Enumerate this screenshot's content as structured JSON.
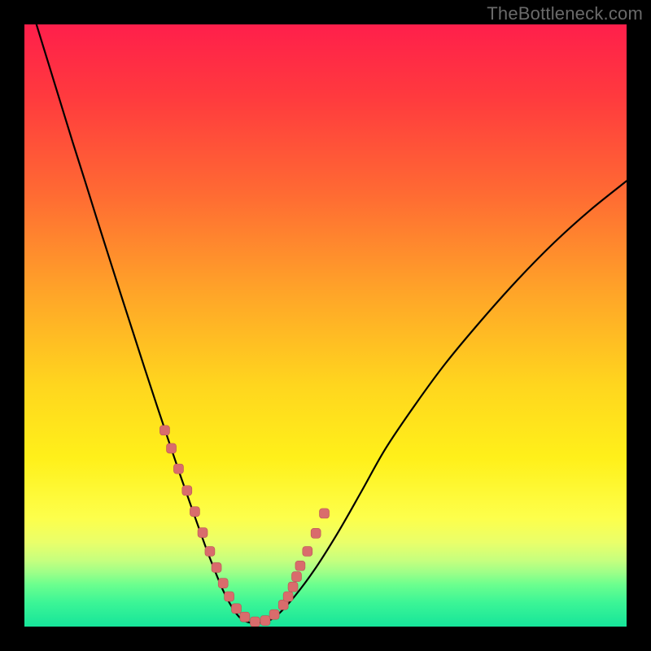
{
  "watermark": "TheBottleneck.com",
  "chart_data": {
    "type": "line",
    "title": "",
    "xlabel": "",
    "ylabel": "",
    "xlim": [
      0,
      1
    ],
    "ylim": [
      0,
      1
    ],
    "series": [
      {
        "name": "curve",
        "x": [
          0.02,
          0.04,
          0.06,
          0.08,
          0.1,
          0.12,
          0.14,
          0.16,
          0.18,
          0.2,
          0.22,
          0.24,
          0.26,
          0.28,
          0.3,
          0.315,
          0.33,
          0.345,
          0.36,
          0.38,
          0.41,
          0.44,
          0.48,
          0.52,
          0.56,
          0.6,
          0.65,
          0.7,
          0.76,
          0.82,
          0.88,
          0.94,
          1.0
        ],
        "y": [
          1.0,
          0.935,
          0.87,
          0.805,
          0.742,
          0.678,
          0.615,
          0.552,
          0.49,
          0.428,
          0.367,
          0.307,
          0.248,
          0.191,
          0.135,
          0.096,
          0.06,
          0.032,
          0.013,
          0.006,
          0.012,
          0.04,
          0.092,
          0.155,
          0.225,
          0.296,
          0.37,
          0.438,
          0.51,
          0.577,
          0.638,
          0.692,
          0.74
        ]
      },
      {
        "name": "markers",
        "x": [
          0.233,
          0.244,
          0.256,
          0.27,
          0.283,
          0.296,
          0.308,
          0.319,
          0.33,
          0.34,
          0.352,
          0.366,
          0.383,
          0.4,
          0.415,
          0.43,
          0.438,
          0.446,
          0.452,
          0.458,
          0.47,
          0.484,
          0.498
        ],
        "y": [
          0.326,
          0.296,
          0.262,
          0.226,
          0.191,
          0.156,
          0.125,
          0.098,
          0.072,
          0.05,
          0.03,
          0.016,
          0.008,
          0.01,
          0.02,
          0.036,
          0.05,
          0.066,
          0.083,
          0.101,
          0.125,
          0.155,
          0.188
        ]
      }
    ]
  }
}
